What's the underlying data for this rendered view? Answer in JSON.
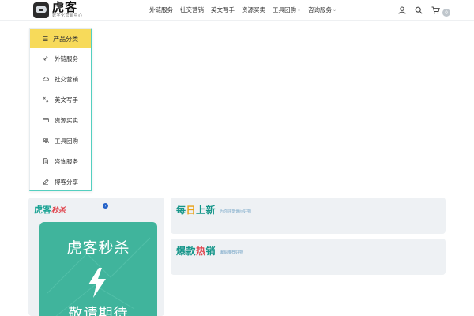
{
  "header": {
    "logo": {
      "main": "虎客",
      "sub": "数字化营销中心"
    },
    "nav": [
      {
        "label": "外链服务",
        "has_dropdown": false
      },
      {
        "label": "社交营销",
        "has_dropdown": false
      },
      {
        "label": "英文写手",
        "has_dropdown": false
      },
      {
        "label": "资源买卖",
        "has_dropdown": false
      },
      {
        "label": "工具团购",
        "has_dropdown": true
      },
      {
        "label": "咨询服务",
        "has_dropdown": true
      }
    ],
    "icons": [
      "user-icon",
      "search-icon",
      "cart-icon"
    ],
    "cart_count": "0"
  },
  "category_menu": {
    "title": "产品分类",
    "items": [
      {
        "label": "外链服务",
        "icon": "link-icon"
      },
      {
        "label": "社交营销",
        "icon": "cloud-icon"
      },
      {
        "label": "英文写手",
        "icon": "translate-icon"
      },
      {
        "label": "资源买卖",
        "icon": "card-icon"
      },
      {
        "label": "工具团购",
        "icon": "group-icon"
      },
      {
        "label": "咨询服务",
        "icon": "document-icon"
      },
      {
        "label": "博客分享",
        "icon": "edit-icon"
      }
    ]
  },
  "flash_sale": {
    "title_main": "虎客",
    "title_accent": "秒杀",
    "card_title": "虎客秒杀",
    "card_sub": "敬请期待"
  },
  "daily_new": {
    "title_a": "每",
    "title_b": "日",
    "title_c": "上新",
    "subtitle": "为你寻觅世间好物"
  },
  "hot_sale": {
    "title_a": "爆款",
    "title_b": "热",
    "title_c": "销",
    "subtitle": "编辑推荐好物"
  },
  "colors": {
    "accent_teal": "#40b49c",
    "menu_header_yellow": "#f7da5a",
    "panel_bg": "#eef1f4",
    "title_teal": "#16968a",
    "accent_orange": "#e9a216",
    "accent_red": "#e0454e"
  }
}
